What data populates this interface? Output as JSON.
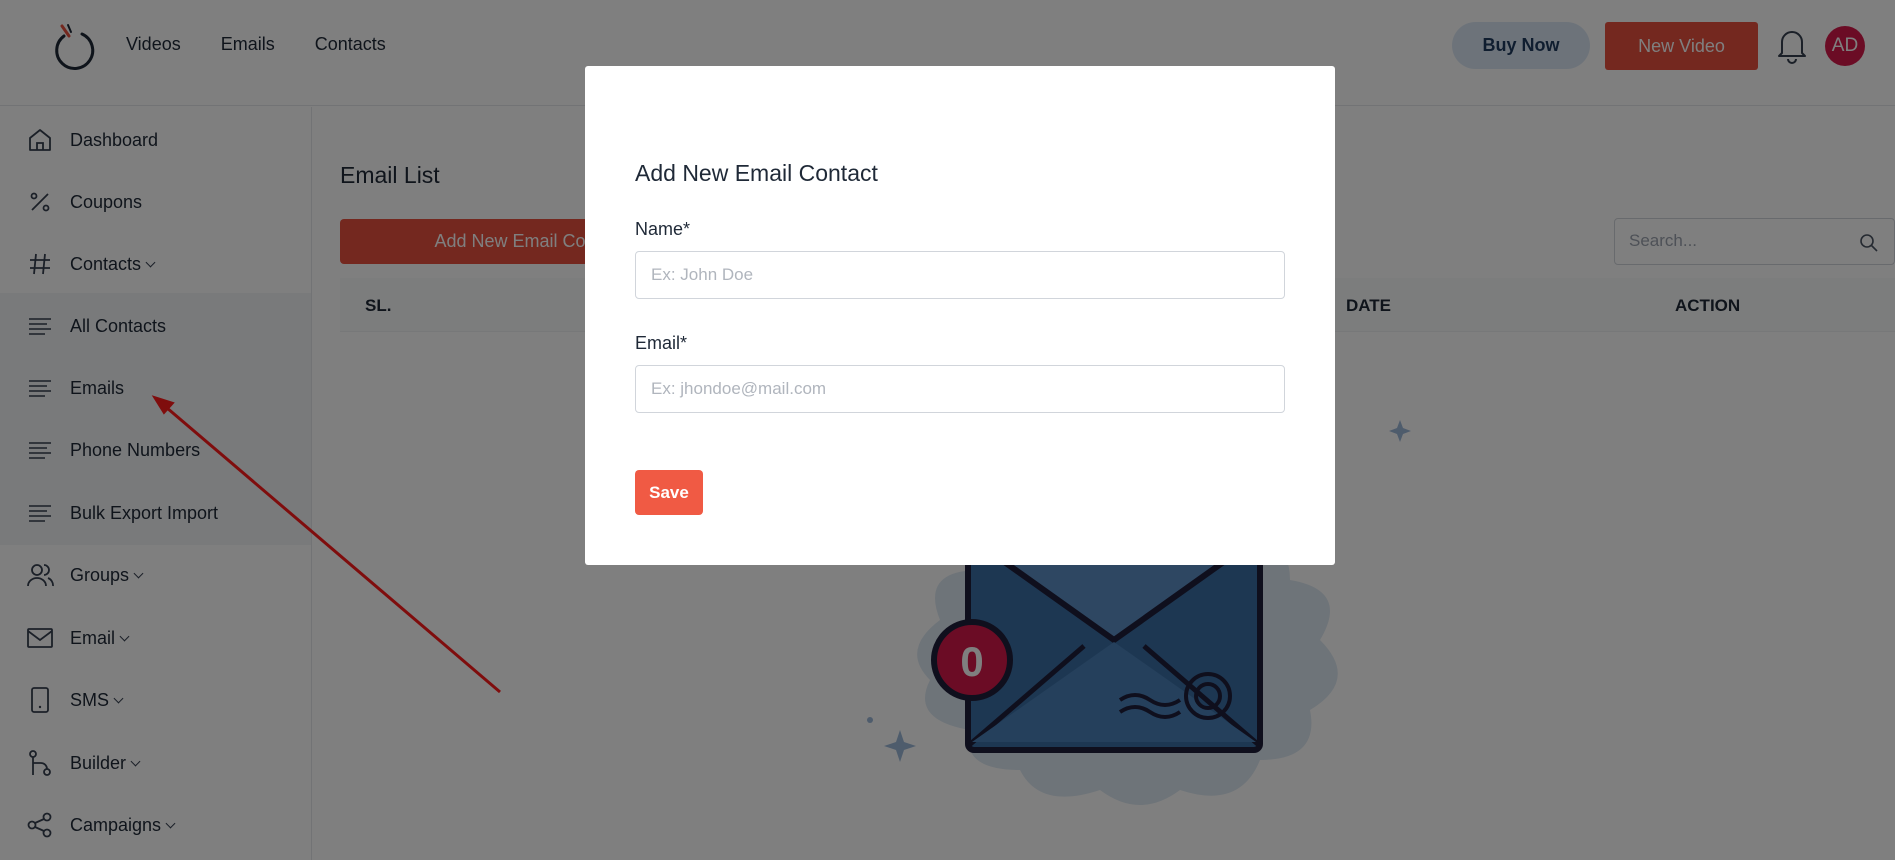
{
  "header": {
    "nav": [
      "Videos",
      "Emails",
      "Contacts"
    ],
    "buy_now": "Buy Now",
    "new_video": "New Video",
    "avatar_initials": "AD"
  },
  "sidebar": {
    "items": [
      {
        "label": "Dashboard",
        "icon": "home-icon",
        "chevron": false
      },
      {
        "label": "Coupons",
        "icon": "percent-icon",
        "chevron": false
      },
      {
        "label": "Contacts",
        "icon": "hash-icon",
        "chevron": true
      },
      {
        "label": "All Contacts",
        "icon": "lines-icon",
        "chevron": false
      },
      {
        "label": "Emails",
        "icon": "lines-icon",
        "chevron": false
      },
      {
        "label": "Phone Numbers",
        "icon": "lines-icon",
        "chevron": false
      },
      {
        "label": "Bulk Export Import",
        "icon": "lines-icon",
        "chevron": false
      },
      {
        "label": "Groups",
        "icon": "users-icon",
        "chevron": true
      },
      {
        "label": "Email",
        "icon": "mail-icon",
        "chevron": true
      },
      {
        "label": "SMS",
        "icon": "phone-icon",
        "chevron": true
      },
      {
        "label": "Builder",
        "icon": "git-branch-icon",
        "chevron": true
      },
      {
        "label": "Campaigns",
        "icon": "share-icon",
        "chevron": true
      }
    ]
  },
  "main": {
    "title": "Email List",
    "add_button": "Add New Email Co",
    "search_placeholder": "Search...",
    "table_headers": [
      "SL.",
      "DATE",
      "ACTION"
    ],
    "empty_badge": "0"
  },
  "modal": {
    "title": "Add New Email Contact",
    "name_label": "Name*",
    "name_placeholder": "Ex: John Doe",
    "email_label": "Email*",
    "email_placeholder": "Ex: jhondoe@mail.com",
    "save": "Save"
  },
  "colors": {
    "accent": "#e8503e",
    "avatar": "#d6194b",
    "buy_now_bg": "#dbe7f5",
    "annotation_arrow": "#ff1a1a"
  }
}
